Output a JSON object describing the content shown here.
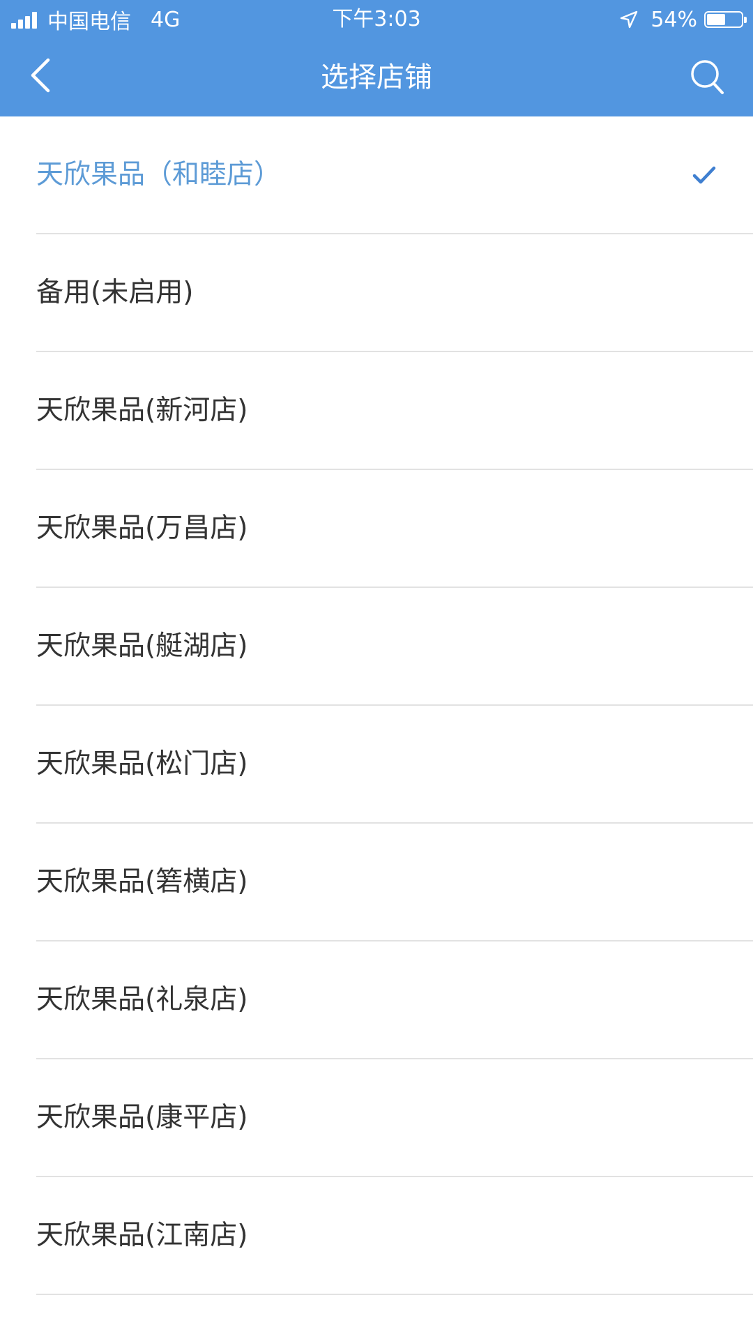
{
  "status_bar": {
    "carrier": "中国电信",
    "network": "4G",
    "time": "下午3:03",
    "battery_text": "54%",
    "battery_level": 0.54
  },
  "nav": {
    "title": "选择店铺",
    "back_icon": "chevron-left-icon",
    "search_icon": "search-icon"
  },
  "stores": [
    {
      "label": "天欣果品（和睦店）",
      "selected": true
    },
    {
      "label": "备用(未启用)",
      "selected": false
    },
    {
      "label": "天欣果品(新河店)",
      "selected": false
    },
    {
      "label": "天欣果品(万昌店)",
      "selected": false
    },
    {
      "label": "天欣果品(艇湖店)",
      "selected": false
    },
    {
      "label": "天欣果品(松门店)",
      "selected": false
    },
    {
      "label": "天欣果品(箬横店)",
      "selected": false
    },
    {
      "label": "天欣果品(礼泉店)",
      "selected": false
    },
    {
      "label": "天欣果品(康平店)",
      "selected": false
    },
    {
      "label": "天欣果品(江南店)",
      "selected": false
    }
  ],
  "colors": {
    "header": "#5296e0",
    "selected_text": "#5d9bd6",
    "check": "#3f7fd0",
    "text": "#333333",
    "divider": "#e2e2e2"
  }
}
